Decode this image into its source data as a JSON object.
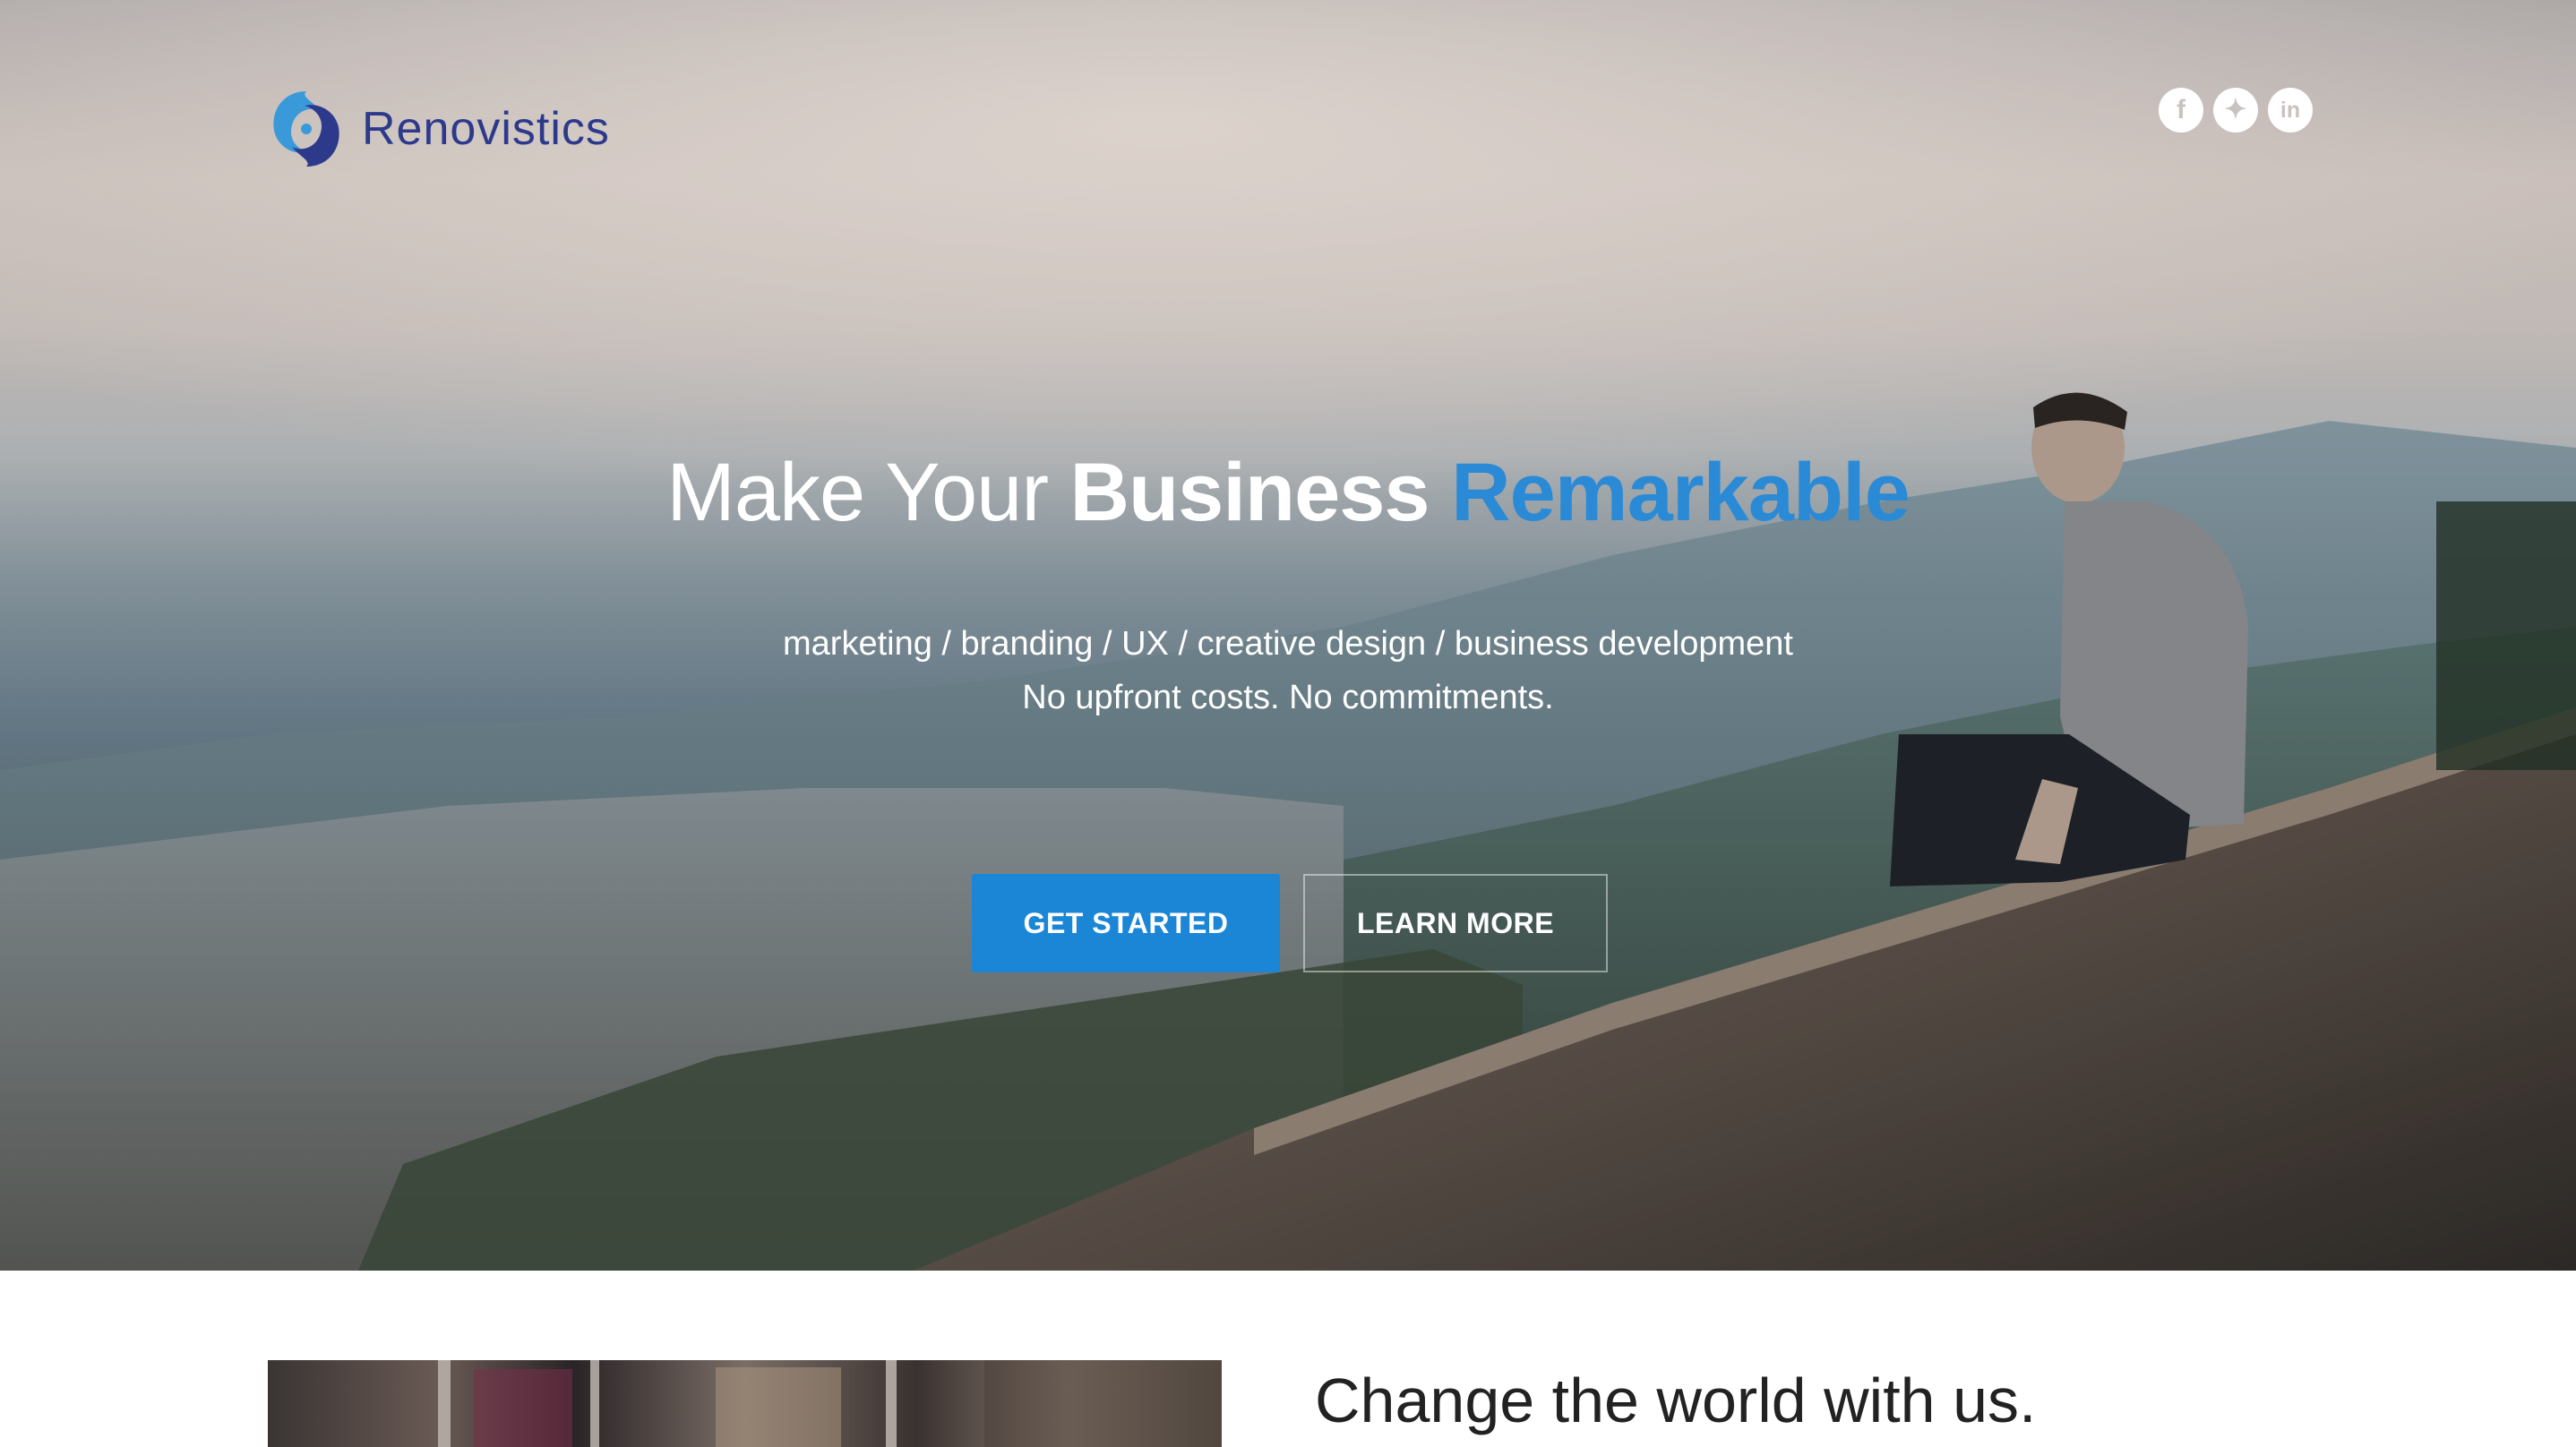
{
  "brand": {
    "name": "Renovistics",
    "text_color": "#2d3a8c",
    "mark_colors": [
      "#3a9ad9",
      "#2d3a8c"
    ]
  },
  "social": [
    {
      "icon": "facebook-icon",
      "glyph": "f"
    },
    {
      "icon": "twitter-icon",
      "glyph": "✦"
    },
    {
      "icon": "linkedin-icon",
      "glyph": "in"
    }
  ],
  "hero": {
    "headline": {
      "part1": "Make Your ",
      "part2": "Business ",
      "part3": "Remarkable"
    },
    "tagline": "marketing / branding / UX / creative design / business development",
    "subtagline": "No upfront costs. No commitments.",
    "primary_button": "GET STARTED",
    "secondary_button": "LEARN MORE",
    "accent_color": "#2b8ad6",
    "button_color": "#1b86d6"
  },
  "section": {
    "title": "Change the world with us."
  }
}
